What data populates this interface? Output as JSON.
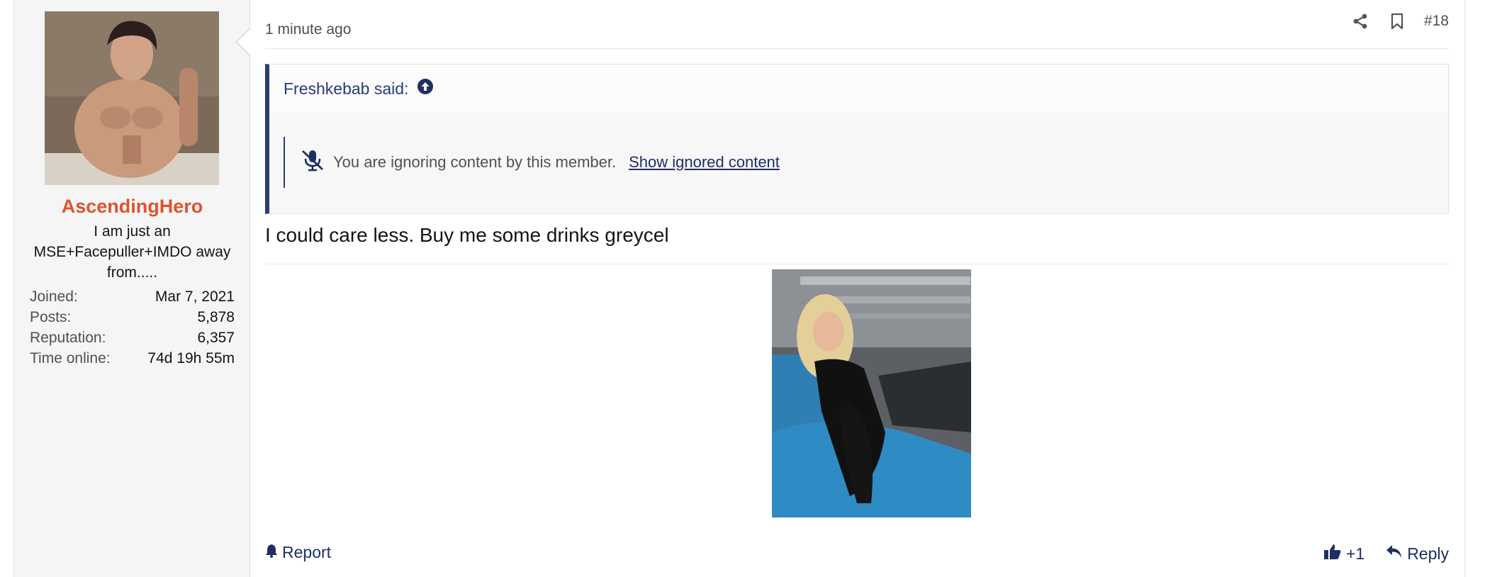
{
  "colors": {
    "username": "#e0522e",
    "accent": "#2a3b7a",
    "link": "#1f2f63",
    "muted": "#505050",
    "sidebar_bg": "#f5f5f5"
  },
  "user": {
    "name": "AscendingHero",
    "title": "I am just an MSE+Facepuller+IMDO away from.....",
    "extras": [
      {
        "label": "Joined:",
        "value": "Mar 7, 2021"
      },
      {
        "label": "Posts:",
        "value": "5,878"
      },
      {
        "label": "Reputation:",
        "value": "6,357"
      },
      {
        "label": "Time online:",
        "value": "74d 19h 55m"
      }
    ]
  },
  "post": {
    "time": "1 minute ago",
    "number": "#18",
    "icons": {
      "share": "share-icon",
      "bookmark": "bookmark-icon"
    },
    "quote": {
      "author_said": "Freshkebab said:",
      "ignored_text": "You are ignoring content by this member.",
      "show_link": "Show ignored content"
    },
    "message": "I could care less. Buy me some drinks greycel",
    "footer": {
      "report": "Report",
      "reaction": "+1",
      "reply": "Reply"
    }
  }
}
